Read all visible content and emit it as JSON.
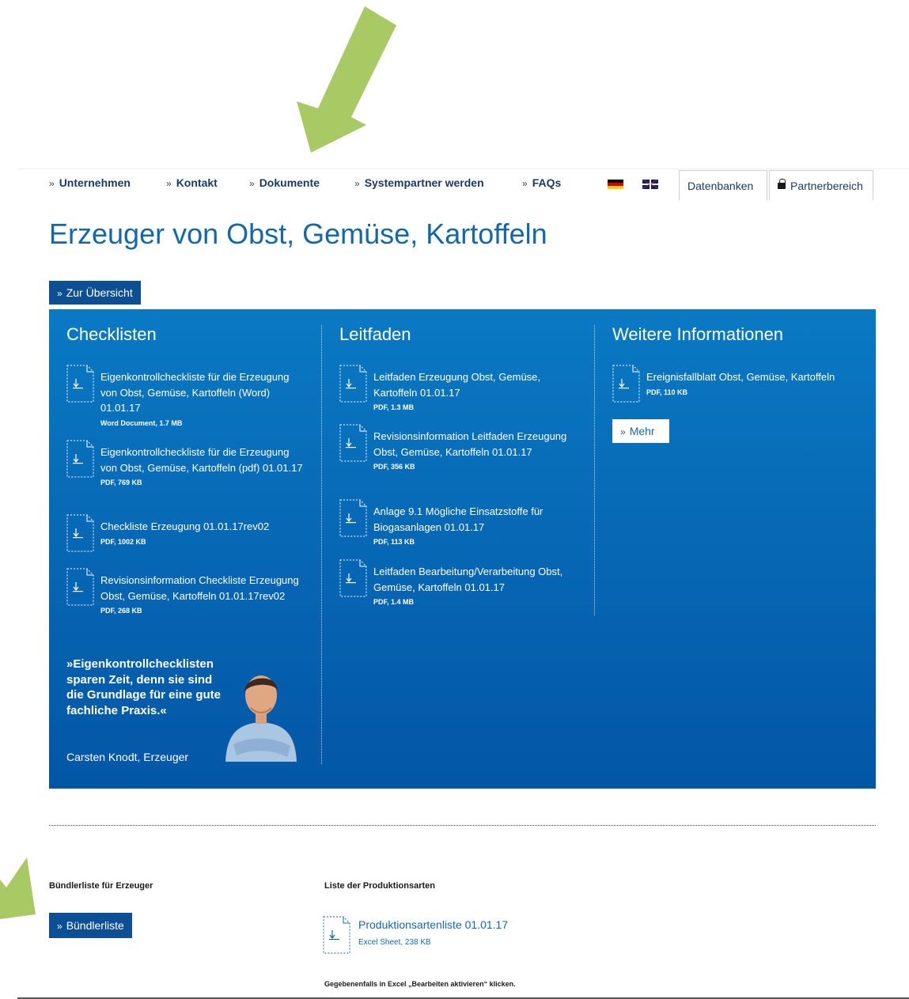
{
  "annotation": {
    "arrow_color": "#a8c964"
  },
  "nav": {
    "items": [
      {
        "label": "Unternehmen"
      },
      {
        "label": "Kontakt"
      },
      {
        "label": "Dokumente"
      },
      {
        "label": "Systempartner werden"
      },
      {
        "label": "FAQs"
      }
    ],
    "languages": [
      "de-flag-icon",
      "uk-flag-icon"
    ],
    "tab_databases": "Datenbanken",
    "tab_partner": "Partnerbereich"
  },
  "page": {
    "title": "Erzeuger von Obst, Gemüse, Kartoffeln",
    "overview_button": "Zur Übersicht"
  },
  "panel": {
    "colors": {
      "top": "#0a79c3",
      "bottom": "#0356a6"
    },
    "checklists": {
      "heading": "Checklisten",
      "items": [
        {
          "title": "Eigenkontrollcheckliste für die Erzeugung von Obst, Gemüse, Kartoffeln (Word) 01.01.17",
          "meta": "Word Document, 1.7 MB"
        },
        {
          "title": "Eigenkontrollcheckliste für die Erzeugung von Obst, Gemüse, Kartoffeln (pdf) 01.01.17",
          "meta": "PDF, 769 KB"
        },
        {
          "title": "Checkliste Erzeugung 01.01.17rev02",
          "meta": "PDF, 1002 KB"
        },
        {
          "title": "Revisionsinformation Checkliste Erzeugung Obst, Gemüse, Kartoffeln 01.01.17rev02",
          "meta": "PDF, 268 KB"
        }
      ],
      "quote": "»Eigenkontrollchecklisten sparen Zeit, denn sie sind die Grundlage für eine gute fachliche Praxis.«",
      "quote_author": "Carsten Knodt, Erzeuger"
    },
    "guides": {
      "heading": "Leitfaden",
      "items": [
        {
          "title": "Leitfaden Erzeugung Obst, Gemüse, Kartoffeln 01.01.17",
          "meta": "PDF, 1.3 MB"
        },
        {
          "title": "Revisionsinformation Leitfaden Erzeugung Obst, Gemüse, Kartoffeln 01.01.17",
          "meta": "PDF, 356 KB"
        },
        {
          "title": "Anlage 9.1 Mögliche Einsatzstoffe für Biogasanlagen 01.01.17",
          "meta": "PDF, 113 KB"
        },
        {
          "title": "Leitfaden Bearbeitung/Verarbeitung Obst, Gemüse, Kartoffeln 01.01.17",
          "meta": "PDF, 1.4 MB"
        }
      ]
    },
    "more_info": {
      "heading": "Weitere Informationen",
      "items": [
        {
          "title": "Ereignisfallblatt Obst, Gemüse, Kartoffeln",
          "meta": "PDF, 110 KB"
        }
      ],
      "more_button": "Mehr"
    }
  },
  "bottom": {
    "bundler_title": "Bündlerliste für Erzeuger",
    "bundler_button": "Bündlerliste",
    "production_title": "Liste der Produktionsarten",
    "production_file": {
      "title": "Produktionsartenliste 01.01.17",
      "meta": "Excel Sheet, 238 KB"
    },
    "hint": "Gegebenenfalls in Excel „Bearbeiten aktivieren“ klicken."
  }
}
